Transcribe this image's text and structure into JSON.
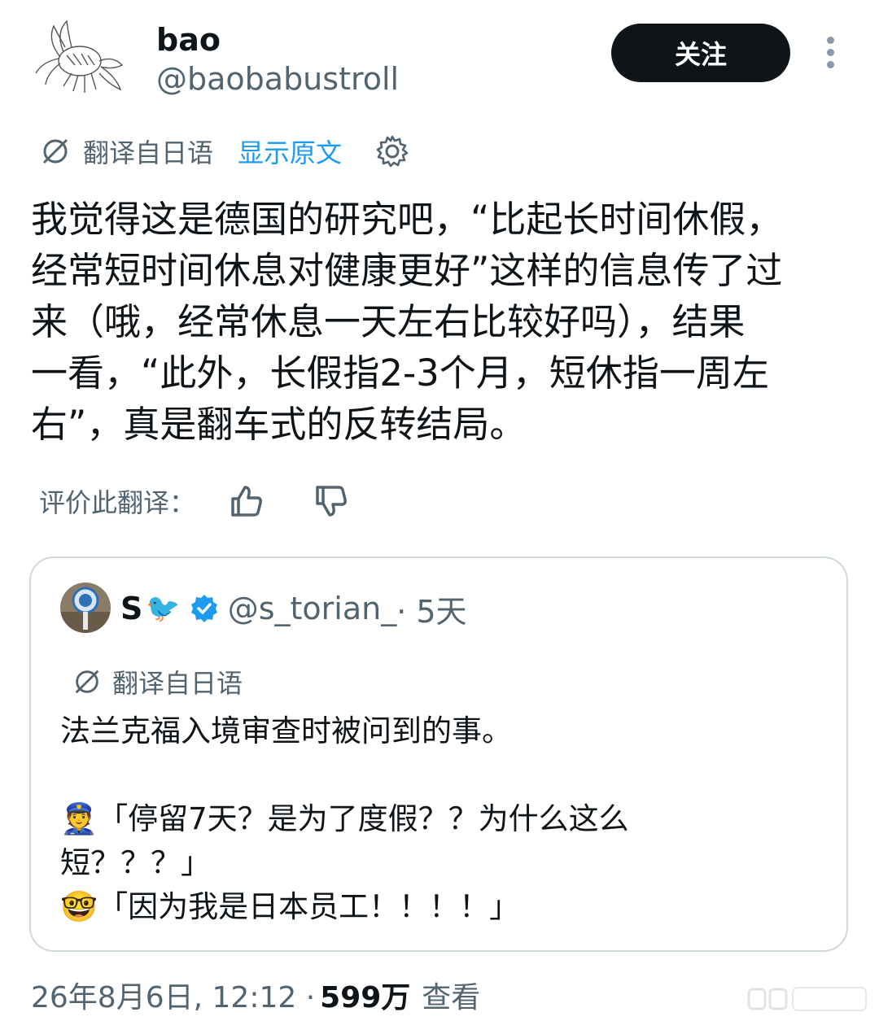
{
  "author": {
    "display_name": "bao",
    "handle": "@baobabustroll",
    "avatar_icon": "crayfish-sketch-icon"
  },
  "follow_button": {
    "label": "关注"
  },
  "more_icon": "more-vertical-icon",
  "translation": {
    "label": "翻译自日语",
    "show_original": "显示原文",
    "settings_icon": "gear-icon"
  },
  "tweet": {
    "text": "我觉得这是德国的研究吧，“比起长时间休假，\n经常短时间休息对健康更好”这样的信息传了过\n来（哦，经常休息一天左右比较好吗），结果\n一看，“此外，长假指2-3个月，短休指一周左\n右”，真是翻车式的反转结局。"
  },
  "rating": {
    "label": "评价此翻译：",
    "thumbs_up_icon": "thumbs-up-icon",
    "thumbs_down_icon": "thumbs-down-icon"
  },
  "quote": {
    "display_name": "S",
    "name_emoji": "🐦",
    "verified_icon": "verified-badge-icon",
    "handle": "@s_torian_",
    "time": " · 5天",
    "translation_label": "翻译自日语",
    "text": "法兰克福入境审查时被问到的事。\n\n👮「停留7天？是为了度假？？为什么这么\n短？？？」\n🤓「因为我是日本员工！！！！」"
  },
  "meta": {
    "timestamp": "26年8月6日, 12:12 ·",
    "views": "599万",
    "views_label": "查看"
  },
  "colors": {
    "text": "#0f1419",
    "secondary": "#536471",
    "link": "#1d9bf0",
    "button_bg": "#0f1419",
    "border": "#cfd9de"
  }
}
